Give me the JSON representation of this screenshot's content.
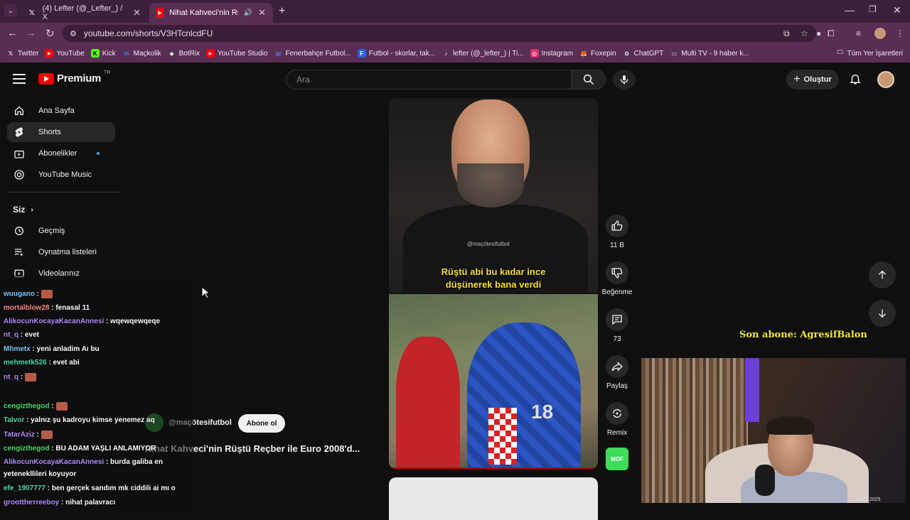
{
  "tabs": [
    {
      "title": "(4) Lefter (@_Lefter_) / X",
      "icon": "x-icon"
    },
    {
      "title": "Nihat Kahveci'nin Rüştü Re",
      "icon": "youtube-icon"
    }
  ],
  "address": {
    "url": "youtube.com/shorts/V3HTcnlcdFU"
  },
  "bookmarks": [
    {
      "label": "Twitter",
      "icon": "x-icon",
      "color": "#ffffff"
    },
    {
      "label": "YouTube",
      "icon": "youtube-icon",
      "color": "#ff0000"
    },
    {
      "label": "Kick",
      "icon": "kick-icon",
      "color": "#53fc18"
    },
    {
      "label": "Maçkolik",
      "icon": "mackolik-icon",
      "color": "#3b82f6"
    },
    {
      "label": "BotRix",
      "icon": "botrix-icon",
      "color": "#e5e5e5"
    },
    {
      "label": "YouTube Studio",
      "icon": "youtube-studio-icon",
      "color": "#ff0000"
    },
    {
      "label": "Fenerbahçe Futbol...",
      "icon": "fenerbahce-icon",
      "color": "#2563eb"
    },
    {
      "label": "Futbol - skorlar, tak...",
      "icon": "flashscore-icon",
      "color": "#2563eb"
    },
    {
      "label": "lefter (@_lefter_) | Ti...",
      "icon": "tiktok-icon",
      "color": "#111111"
    },
    {
      "label": "Instagram",
      "icon": "instagram-icon",
      "color": "#e1306c"
    },
    {
      "label": "Foxepin",
      "icon": "foxepin-icon",
      "color": "#f59e0b"
    },
    {
      "label": "ChatGPT",
      "icon": "chatgpt-icon",
      "color": "#e5e5e5"
    },
    {
      "label": "Multi TV - 9 haber k...",
      "icon": "multitv-icon",
      "color": "#e5e5e5"
    }
  ],
  "bookmarks_all": "Tüm Yer İşaretleri",
  "yt": {
    "brand": "Premium",
    "region": "TR",
    "search_placeholder": "Ara",
    "create_label": "Oluştur"
  },
  "sidebar": {
    "items": [
      {
        "label": "Ana Sayfa",
        "icon": "home-icon"
      },
      {
        "label": "Shorts",
        "icon": "shorts-icon"
      },
      {
        "label": "Abonelikler",
        "icon": "subscriptions-icon"
      },
      {
        "label": "YouTube Music",
        "icon": "youtube-music-icon"
      }
    ],
    "you_label": "Siz",
    "you_items": [
      {
        "label": "Geçmiş",
        "icon": "history-icon"
      },
      {
        "label": "Oynatma listeleri",
        "icon": "playlists-icon"
      },
      {
        "label": "Videolarınız",
        "icon": "your-videos-icon"
      }
    ]
  },
  "chat": [
    {
      "user": "wuugano",
      "message": ":",
      "user_color": "#7cc7ff",
      "emote": true
    },
    {
      "user": "mortalblow28",
      "message": ": fenasal 11",
      "user_color": "#ff8a8a"
    },
    {
      "user": "AlikocunKocayaKacanAnnesi",
      "message": ": wqewqewqeqe",
      "user_color": "#b48cff"
    },
    {
      "user": "nt_q",
      "message": ": evet",
      "user_color": "#b48cff"
    },
    {
      "user": "Mhmetx",
      "message": ": yeni anladim Aı bu",
      "user_color": "#7cc7ff"
    },
    {
      "user": "mehmetk526",
      "message": ": evet abi",
      "user_color": "#4ddbb0"
    },
    {
      "user": "nt_q",
      "message": ":",
      "user_color": "#b48cff",
      "emote": true
    },
    {
      "user": "cengizthegod",
      "message": ":",
      "user_color": "#4ddb6a",
      "emote": true
    },
    {
      "user": "Talvor",
      "message": ": yalnız şu kadroyu kimse yenemez aq",
      "user_color": "#4ddbb0"
    },
    {
      "user": "TatarAziz",
      "message": ":",
      "user_color": "#b48cff",
      "emote": true
    },
    {
      "user": "cengizthegod",
      "message": ": BU ADAM YAŞLI ANLAMIYOR",
      "user_color": "#4ddb6a"
    },
    {
      "user": "AlikocunKocayaKacanAnnesi",
      "message": ": burda galiba en",
      "user_color": "#b48cff"
    },
    {
      "user": "",
      "message": "yetenekllileri koyuyor",
      "user_color": "#ffffff"
    },
    {
      "user": "efe_1907777",
      "message": ": ben gerçek sandım mk ciddili ai mı o",
      "user_color": "#4ddbb0"
    },
    {
      "user": "groottheтreeboy",
      "message": ": nihat palavracı",
      "user_color": "#b48cff"
    }
  ],
  "short": {
    "caption_line1": "Rüştü abi bu kadar ince",
    "caption_line2": "düşünerek bana verdi",
    "watermark": "@maçötesifutbol",
    "jersey_number": "18",
    "channel": "@maçötesifutbol",
    "subscribe_label": "Abone ol",
    "title": "Nihat Kahveci'nin Rüştü Reçber ile Euro 2008'd..."
  },
  "actions": {
    "likes": "11 B",
    "dislike_label": "Beğenme",
    "comments": "73",
    "share_label": "Paylaş",
    "remix_label": "Remix",
    "sound_label": "MOF"
  },
  "stream": {
    "last_sub": "Son abone: AgresifBalon",
    "date": "14.11.2025"
  }
}
